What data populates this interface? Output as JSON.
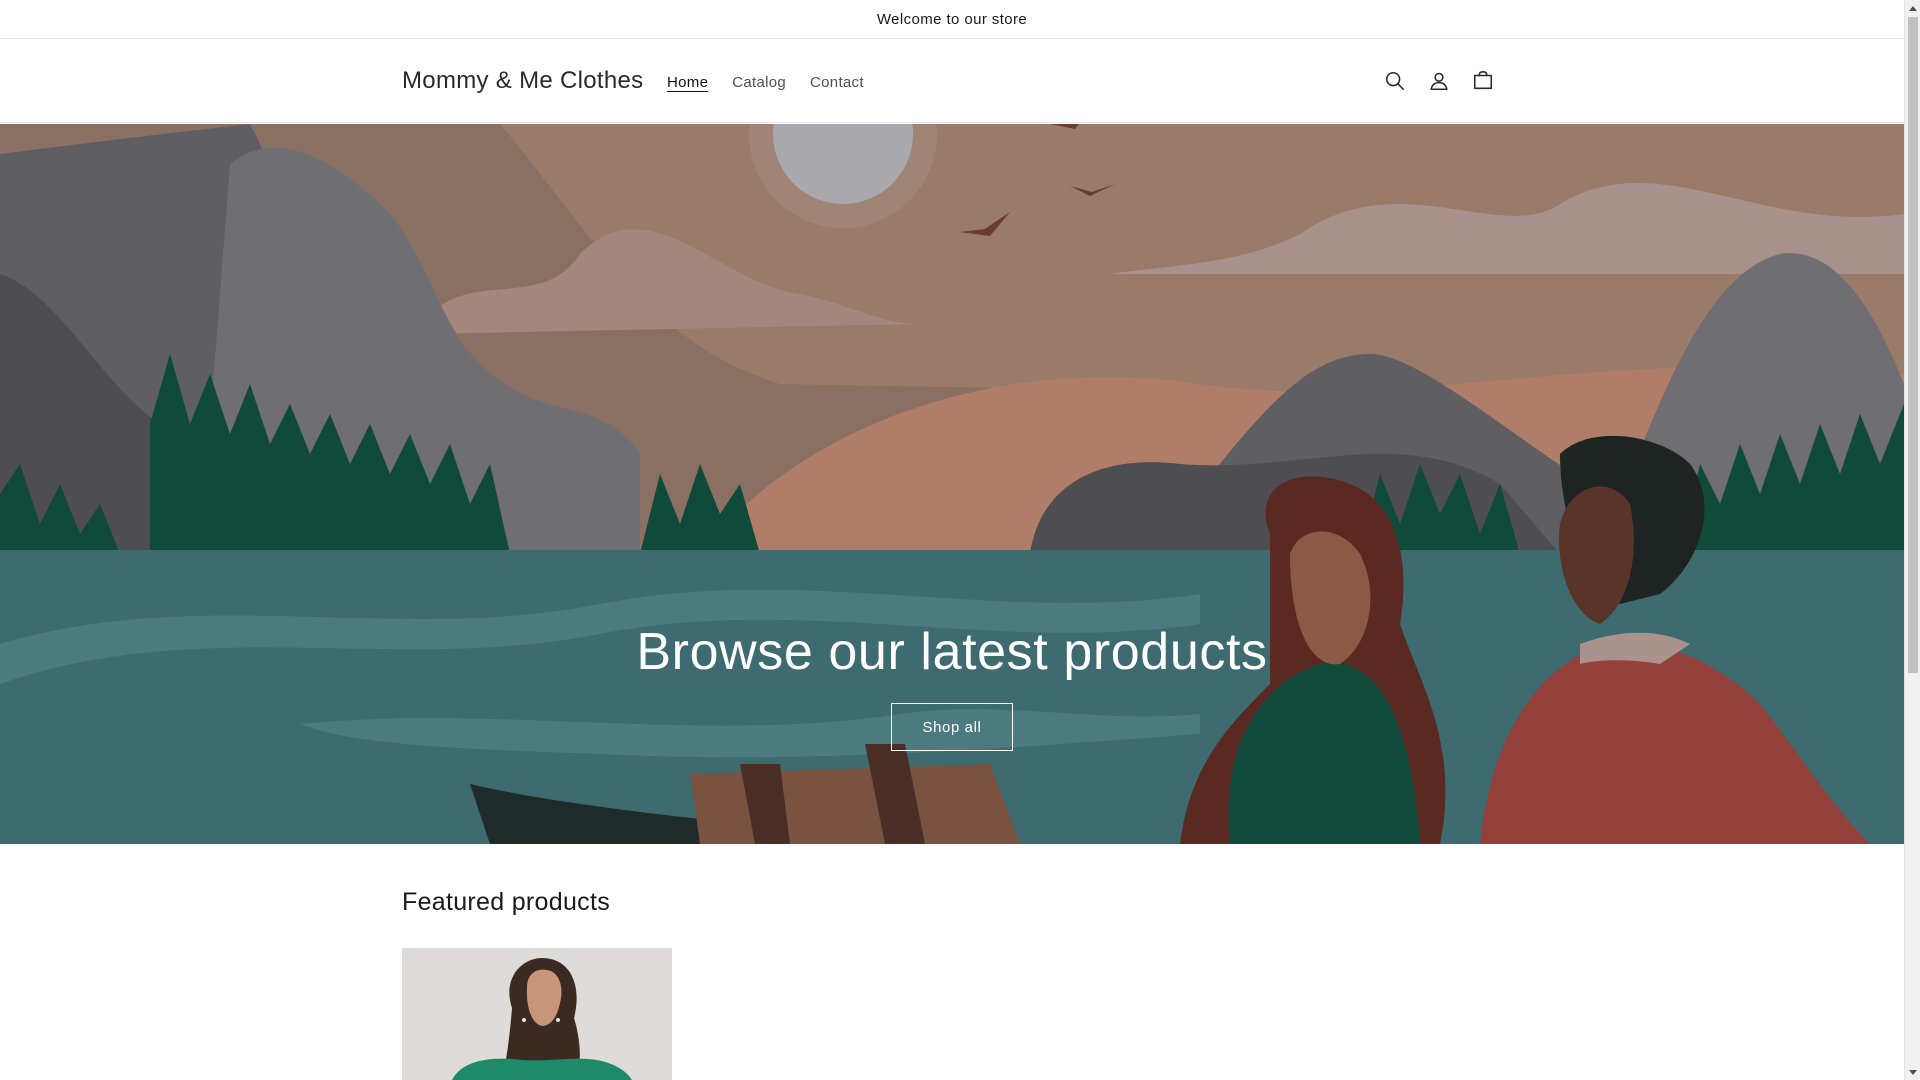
{
  "announcement": {
    "text": "Welcome to our store"
  },
  "header": {
    "logo": "Mommy & Me Clothes",
    "nav": [
      {
        "label": "Home",
        "active": true
      },
      {
        "label": "Catalog",
        "active": false
      },
      {
        "label": "Contact",
        "active": false
      }
    ],
    "icons": [
      "search-icon",
      "account-icon",
      "cart-icon"
    ]
  },
  "hero": {
    "title": "Browse our latest products",
    "button_label": "Shop all"
  },
  "featured": {
    "title": "Featured products"
  },
  "colors": {
    "sky": "#8a7062",
    "lake": "#3d6b70",
    "forest": "#0f4a3a",
    "mountain": "#5f5f63",
    "sun": "#a9a9ad"
  }
}
